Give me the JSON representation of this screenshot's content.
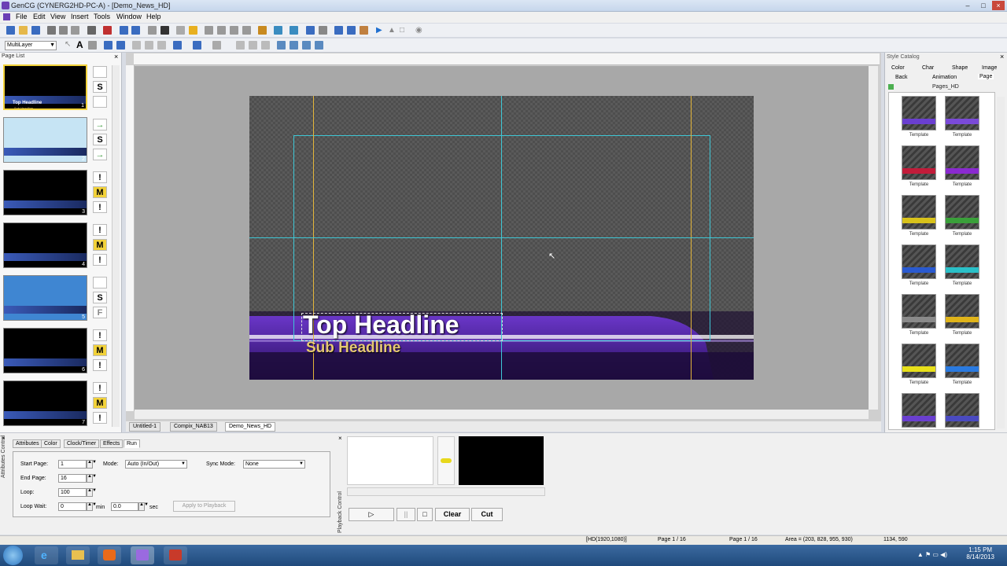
{
  "window": {
    "title": "GenCG (CYNERG2HD-PC-A) - [Demo_News_HD]",
    "minimize": "–",
    "maximize": "□",
    "close": "×"
  },
  "menu": [
    "File",
    "Edit",
    "View",
    "Insert",
    "Tools",
    "Window",
    "Help"
  ],
  "toolbar": {
    "layer_select": "MultiLayer"
  },
  "page_list": {
    "title": "Page List",
    "pages": [
      {
        "num": "1",
        "bg": "#000000",
        "selected": true,
        "icons": [
          "",
          "S",
          ""
        ]
      },
      {
        "num": "2",
        "bg": "#c6e4f4",
        "selected": false,
        "icons": [
          "→",
          "S",
          "→"
        ]
      },
      {
        "num": "3",
        "bg": "#000000",
        "selected": false,
        "icons": [
          "!",
          "M",
          "!"
        ]
      },
      {
        "num": "4",
        "bg": "#000000",
        "selected": false,
        "icons": [
          "!",
          "M",
          "!"
        ]
      },
      {
        "num": "5",
        "bg": "#3f86d2",
        "selected": false,
        "icons": [
          "",
          "S",
          "F"
        ]
      },
      {
        "num": "6",
        "bg": "#000000",
        "selected": false,
        "icons": [
          "!",
          "M",
          "!"
        ]
      },
      {
        "num": "7",
        "bg": "#000000",
        "selected": false,
        "icons": [
          "!",
          "M",
          "!"
        ]
      }
    ],
    "thumb1_headline": "Top Headline",
    "thumb1_sub": "Sub Headline"
  },
  "canvas": {
    "headline": "Top Headline",
    "subheadline": "Sub Headline"
  },
  "doc_tabs": [
    "Untitled-1",
    "Compix_NAB13",
    "Demo_News_HD"
  ],
  "style_catalog": {
    "title": "Style Catalog",
    "tabs_row1": [
      "Color",
      "Char",
      "Shape",
      "Image"
    ],
    "tabs_row2": [
      "Back",
      "Animation",
      "Page"
    ],
    "group": "Pages_HD",
    "template_label": "Template",
    "templates": [
      {
        "accent": "#6a3fd0"
      },
      {
        "accent": "#7a4ad8"
      },
      {
        "accent": "#c21c3a"
      },
      {
        "accent": "#8a2ad0"
      },
      {
        "accent": "#d8c21a"
      },
      {
        "accent": "#3aa03a"
      },
      {
        "accent": "#2a5ad0"
      },
      {
        "accent": "#2ac0c8"
      },
      {
        "accent": "#8a8a8a"
      },
      {
        "accent": "#e0b41a"
      },
      {
        "accent": "#e8e01a"
      },
      {
        "accent": "#2a7ae0"
      },
      {
        "accent": "#6a3fd0"
      },
      {
        "accent": "#4a4ac0"
      }
    ]
  },
  "attributes": {
    "vertical_label": "Attributes Control",
    "tabs": [
      "Attributes",
      "Color",
      "Clock/Timer",
      "Effects",
      "Run"
    ],
    "start_page_label": "Start Page:",
    "start_page": "1",
    "end_page_label": "End Page:",
    "end_page": "16",
    "loop_label": "Loop:",
    "loop": "100",
    "loop_wait_label": "Loop Wait:",
    "loop_wait_min": "0",
    "min_unit": "min",
    "loop_wait_sec": "0.0",
    "sec_unit": "sec",
    "mode_label": "Mode:",
    "mode": "Auto (In/Out)",
    "sync_label": "Sync Mode:",
    "sync": "None",
    "apply": "Apply to Playback"
  },
  "playback": {
    "vertical_label": "Playback Control",
    "play": "▷",
    "pause": "||",
    "stop": "□",
    "clear": "Clear",
    "cut": "Cut"
  },
  "status": {
    "resolution": "[HD(1920,1080)]",
    "page_a": "Page 1 / 16",
    "page_b": "Page 1 / 16",
    "area": "Area = (203, 828, 955, 930)",
    "coords": "1134, 590"
  },
  "taskbar": {
    "time": "1:15 PM",
    "date": "8/14/2013"
  },
  "colors": {
    "guide_yellow": "#e3b53a",
    "guide_cyan": "#3ec7d6",
    "lower_third_purple": "#5a2ab8"
  }
}
